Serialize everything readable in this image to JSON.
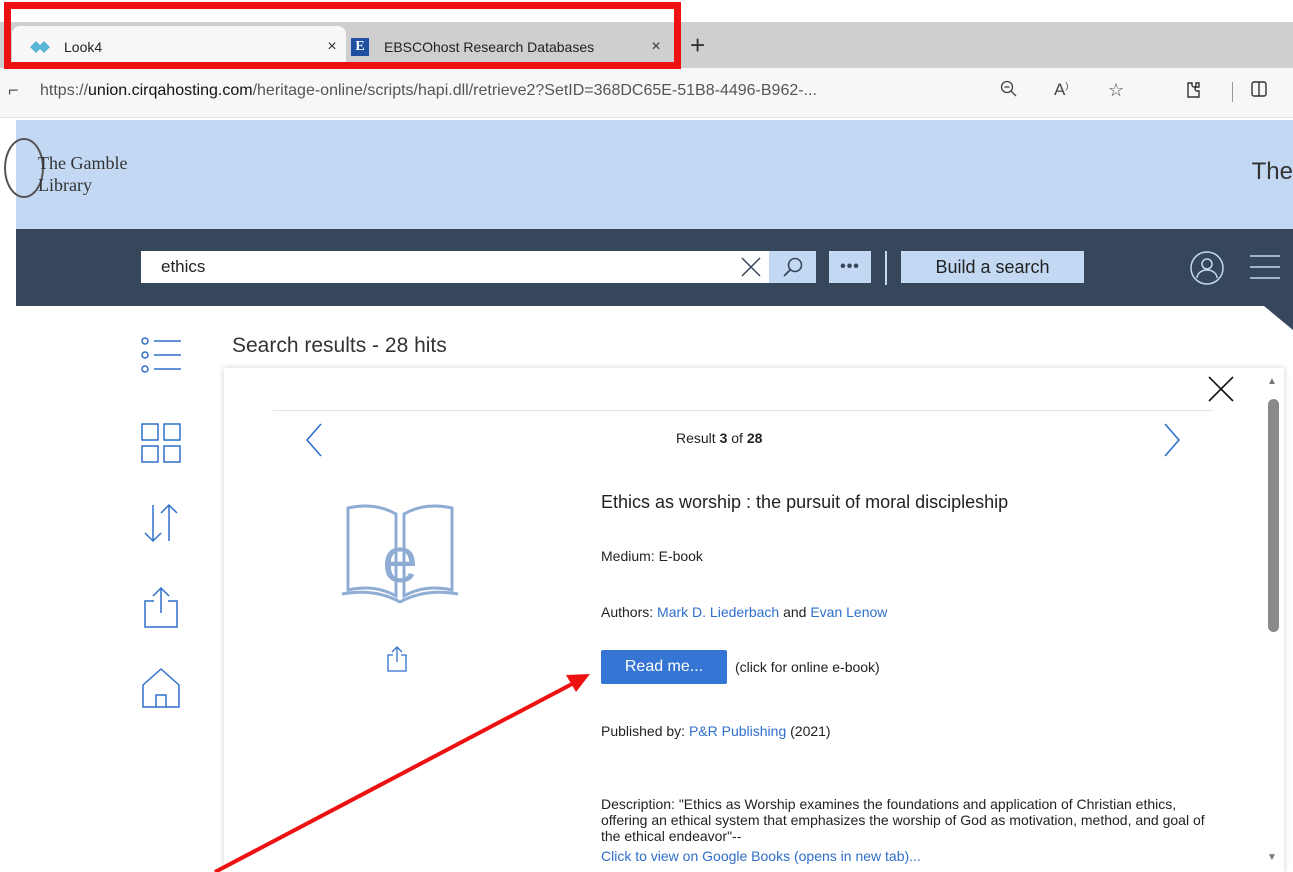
{
  "browser": {
    "tabs": [
      {
        "title": "Look4",
        "close": "×",
        "active": true
      },
      {
        "title": "EBSCOhost Research Databases",
        "close": "×",
        "active": false,
        "favicon_letter": "E"
      }
    ],
    "new_tab": "+",
    "url_prefix": "https://",
    "url_domain": "union.cirqahosting.com",
    "url_rest": "/heritage-online/scripts/hapi.dll/retrieve2?SetID=368DC65E-51B8-4496-B962-...",
    "icons": [
      "zoom-out-icon",
      "read-aloud-icon",
      "favorite-star-icon",
      "extensions-icon",
      "split-screen-icon"
    ]
  },
  "site": {
    "logo_line1": "The Gamble",
    "logo_line2": "Library",
    "header_right": "The"
  },
  "search": {
    "query": "ethics",
    "more_label": "•••",
    "build_label": "Build a search"
  },
  "results": {
    "title": "Search results - 28 hits",
    "nav": {
      "prefix": "Result ",
      "current": "3",
      "middle": " of ",
      "total": "28"
    }
  },
  "record": {
    "title": "Ethics as worship : the pursuit of moral discipleship",
    "medium_label": "Medium: ",
    "medium_value": "E-book",
    "authors_label": "Authors: ",
    "author1": "Mark D. Liederbach",
    "authors_join": " and ",
    "author2": "Evan Lenow",
    "read_button": "Read me...",
    "read_note": "(click for online e-book)",
    "published_label": "Published by: ",
    "publisher": "P&R Publishing",
    "year": " (2021)",
    "description_label": "Description: ",
    "description": "\"Ethics as Worship examines the foundations and application of Christian ethics, offering an ethical system that emphasizes the worship of God as motivation, method, and goal of the ethical endeavor\"--",
    "google_books": "Click to view on Google Books (opens in new tab)...",
    "cover_letter": "e"
  },
  "colors": {
    "header_bg": "#c3d9f3",
    "band_bg": "#37475b",
    "link": "#2f6fcb",
    "button": "#3575d3",
    "annotation": "#ee1111"
  }
}
